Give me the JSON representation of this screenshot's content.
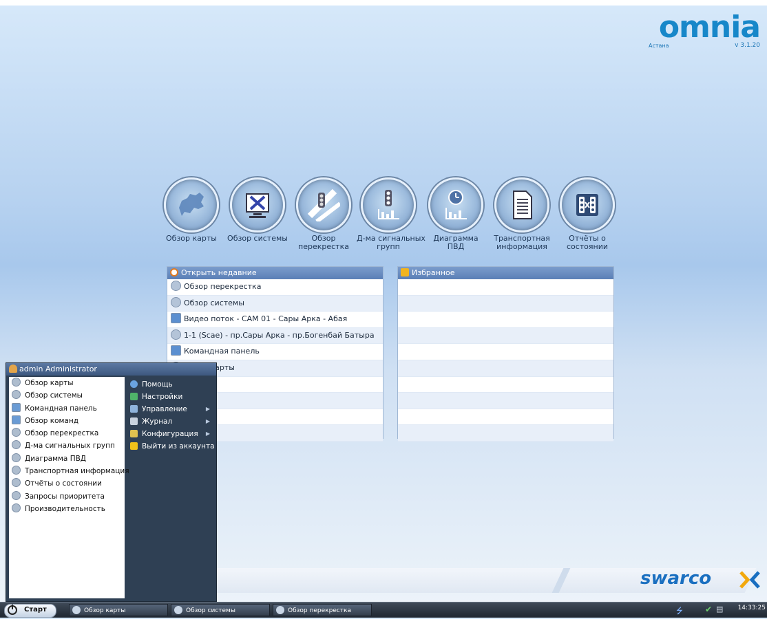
{
  "brand": {
    "logo": "omnia",
    "city": "Астана",
    "version": "v 3.1.20"
  },
  "launcher": [
    {
      "label": "Обзор карты",
      "icon": "map-overview-icon"
    },
    {
      "label": "Обзор системы",
      "icon": "system-overview-icon"
    },
    {
      "label": "Обзор\nперекрестка",
      "icon": "intersection-overview-icon"
    },
    {
      "label": "Д-ма сигнальных\nгрупп",
      "icon": "signal-groups-icon"
    },
    {
      "label": "Диаграмма ПВД",
      "icon": "pvd-diagram-icon"
    },
    {
      "label": "Транспортная\nинформация",
      "icon": "transport-info-icon"
    },
    {
      "label": "Отчёты о\nсостоянии",
      "icon": "status-reports-icon"
    }
  ],
  "recent": {
    "title": "Открыть недавние",
    "items": [
      "Обзор перекрестка",
      "Обзор системы",
      "Видео поток - CAM 01 - Сары Арка - Абая",
      "1-1 (Scae) - пр.Сары Арка - пр.Богенбай Батыра",
      "Командная панель",
      "Обзор карты"
    ]
  },
  "favorites": {
    "title": "Избранное"
  },
  "startmenu": {
    "user": "admin Administrator",
    "left": [
      "Обзор карты",
      "Обзор системы",
      "Командная панель",
      "Обзор команд",
      "Обзор перекрестка",
      "Д-ма сигнальных групп",
      "Диаграмма ПВД",
      "Транспортная информация",
      "Отчёты о состоянии",
      "Запросы приоритета",
      "Производительность"
    ],
    "right": [
      {
        "label": "Помощь",
        "submenu": false
      },
      {
        "label": "Настройки",
        "submenu": false
      },
      {
        "label": "Управление",
        "submenu": true
      },
      {
        "label": "Журнал",
        "submenu": true
      },
      {
        "label": "Конфигурация",
        "submenu": true
      },
      {
        "label": "Выйти из аккаунта",
        "submenu": false
      }
    ]
  },
  "footer_brand": "swarco",
  "taskbar": {
    "start": "Старт",
    "tasks": [
      "Обзор карты",
      "Обзор системы",
      "Обзор перекрестка"
    ],
    "clock": "14:33:25"
  }
}
